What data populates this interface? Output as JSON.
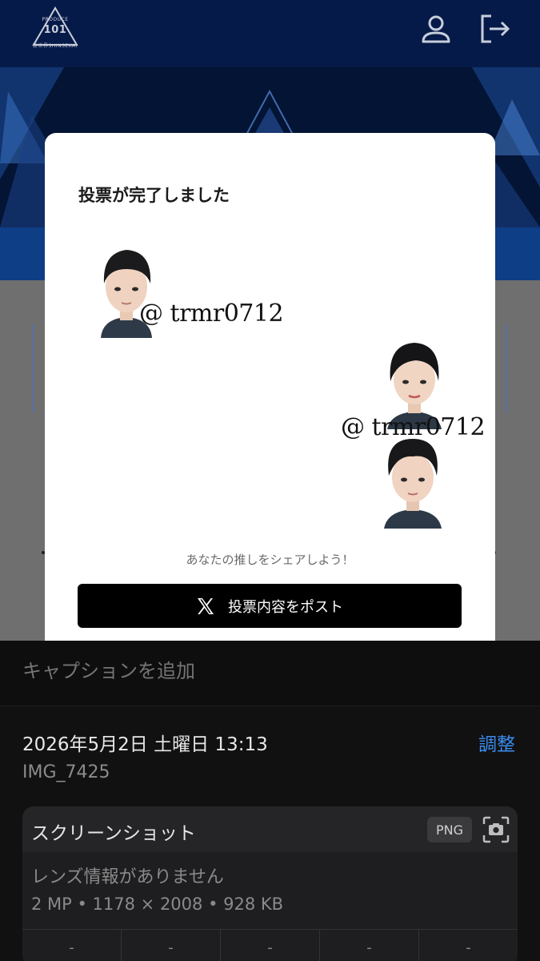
{
  "header": {
    "logo_line1": "PRODUCE",
    "logo_line2": "101",
    "logo_line3": "新世界SHINSEKAI",
    "user_icon": "user-icon",
    "logout_icon": "logout-icon"
  },
  "modal": {
    "title": "投票が完了しました",
    "watermarks": [
      "@ trmr0712",
      "@ trmr0712"
    ],
    "share_prompt": "あなたの推しをシェアしよう！",
    "post_button_label": "投票内容をポスト",
    "post_button_icon": "x-logo-icon"
  },
  "photo_info": {
    "caption_placeholder": "キャプションを追加",
    "date": "2026年5月2日 土曜日 13:13",
    "adjust_label": "調整",
    "filename": "IMG_7425",
    "card": {
      "title": "スクリーンショット",
      "format_badge": "PNG",
      "lens_info": "レンズ情報がありません",
      "specs": "2 MP • 1178 × 2008 • 928 KB",
      "exif_values": [
        "-",
        "-",
        "-",
        "-",
        "-"
      ]
    }
  },
  "colors": {
    "header_bg": "#061a49",
    "accent_blue": "#3b8df0",
    "button_bg": "#000000"
  }
}
